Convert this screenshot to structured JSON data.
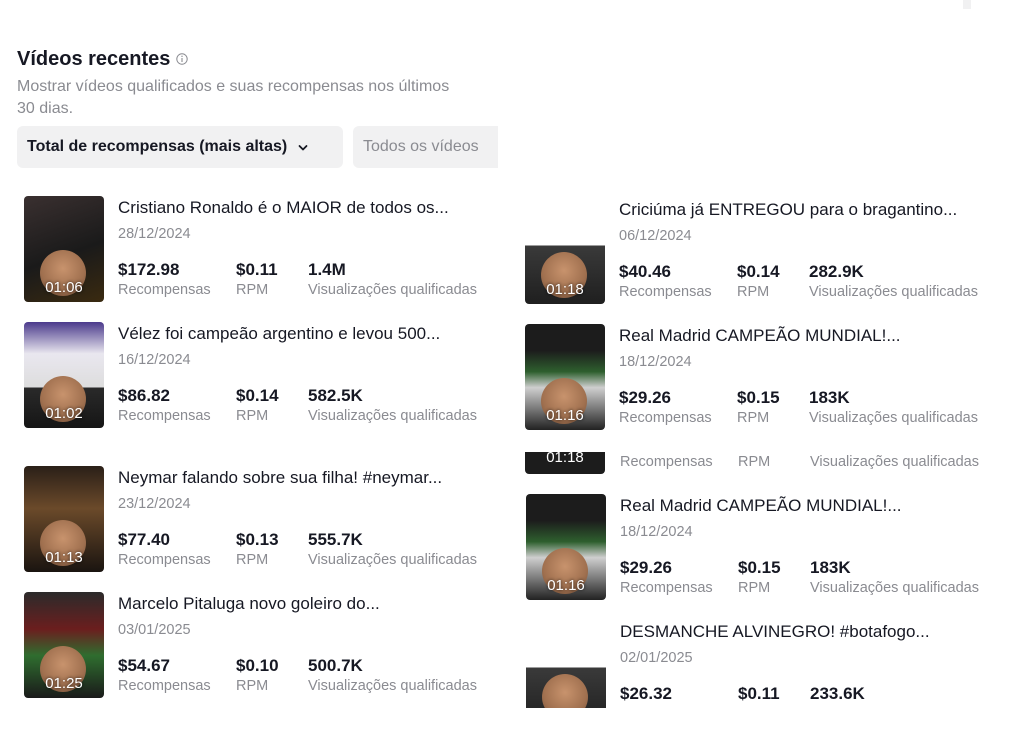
{
  "header": {
    "title": "Vídeos recentes",
    "subtitle": "Mostrar vídeos qualificados e suas recompensas nos últimos 30 dias."
  },
  "filters": {
    "sort_label": "Total de recompensas (mais altas)",
    "scope_label": "Todos os vídeos"
  },
  "labels": {
    "rewards": "Recompensas",
    "rpm": "RPM",
    "views": "Visualizações qualificadas"
  },
  "left_videos": [
    {
      "title": "Cristiano Ronaldo é o MAIOR de todos os...",
      "date": "28/12/2024",
      "duration": "01:06",
      "rewards": "$172.98",
      "rpm": "$0.11",
      "views": "1.4M"
    },
    {
      "title": "Vélez foi campeão argentino e levou 500...",
      "date": "16/12/2024",
      "duration": "01:02",
      "rewards": "$86.82",
      "rpm": "$0.14",
      "views": "582.5K"
    },
    {
      "title": "Neymar falando sobre sua filha! #neymar...",
      "date": "23/12/2024",
      "duration": "01:13",
      "rewards": "$77.40",
      "rpm": "$0.13",
      "views": "555.7K"
    },
    {
      "title": "Marcelo Pitaluga novo goleiro do...",
      "date": "03/01/2025",
      "duration": "01:25",
      "rewards": "$54.67",
      "rpm": "$0.10",
      "views": "500.7K"
    }
  ],
  "right_videos": [
    {
      "title": "Criciúma já ENTREGOU para o bragantino...",
      "date": "06/12/2024",
      "duration": "01:18",
      "rewards": "$40.46",
      "rpm": "$0.14",
      "views": "282.9K"
    },
    {
      "title": "Real Madrid CAMPEÃO MUNDIAL!...",
      "date": "18/12/2024",
      "duration": "01:16",
      "rewards": "$29.26",
      "rpm": "$0.15",
      "views": "183K"
    },
    {
      "title": "Real Madrid CAMPEÃO MUNDIAL!...",
      "date": "18/12/2024",
      "duration": "01:16",
      "rewards": "$29.26",
      "rpm": "$0.15",
      "views": "183K"
    },
    {
      "title": "DESMANCHE ALVINEGRO! #botafogo...",
      "date": "02/01/2025",
      "duration": "",
      "rewards": "$26.32",
      "rpm": "$0.11",
      "views": "233.6K"
    }
  ],
  "partial_row": {
    "duration": "01:18"
  },
  "colors": {
    "text": "#161823",
    "muted": "#8a8b91",
    "chip_bg": "#f1f1f2",
    "background": "#ffffff"
  },
  "icons": {
    "info": "info-circle-icon",
    "chevron": "chevron-down-icon"
  }
}
